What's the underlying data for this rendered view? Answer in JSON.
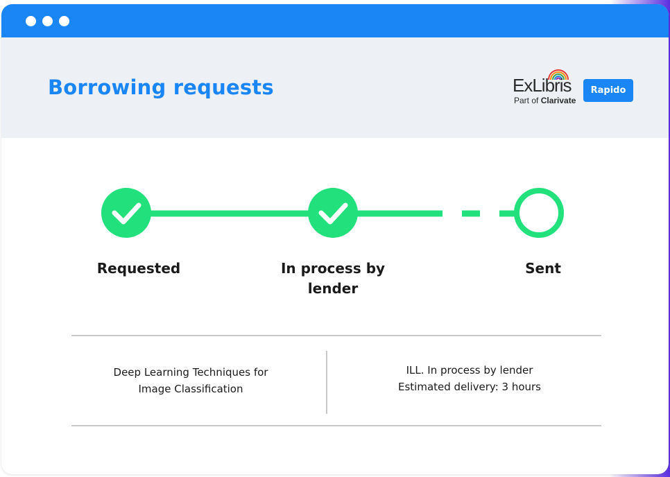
{
  "window": {
    "controls": [
      "window-dot",
      "window-dot",
      "window-dot"
    ]
  },
  "header": {
    "title": "Borrowing requests",
    "logo": {
      "brand": "ExLibris",
      "tagline_prefix": "Part of",
      "tagline_brand": "Clarivate"
    },
    "badge": "Rapido"
  },
  "progress": {
    "steps": [
      {
        "label": "Requested",
        "status": "complete",
        "icon": "check-icon"
      },
      {
        "label": "In process by lender",
        "status": "complete",
        "icon": "check-icon"
      },
      {
        "label": "Sent",
        "status": "pending",
        "icon": "empty-circle-icon"
      }
    ]
  },
  "details": {
    "title_lines": [
      "Deep Learning Techniques for",
      "Image Classification"
    ],
    "status_lines": [
      "ILL. In process by lender",
      "Estimated delivery: 3 hours"
    ]
  },
  "colors": {
    "primary": "#1a86f5",
    "success": "#22e07c",
    "header_bg": "#edf0f4"
  }
}
